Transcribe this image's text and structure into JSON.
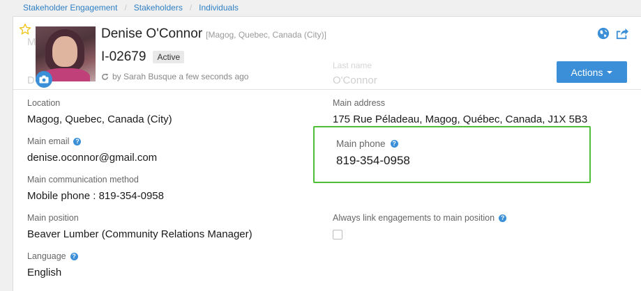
{
  "breadcrumb": [
    "Stakeholder Engagement",
    "Stakeholders",
    "Individuals"
  ],
  "header": {
    "name": "Denise O'Connor",
    "location_tag": "[Magog, Quebec, Canada (City)]",
    "identifier": "I-02679",
    "status": "Active",
    "updated_text": "by Sarah Busque a few seconds ago",
    "actions_label": "Actions",
    "ghost_last_name_label": "Last name",
    "ghost_last_name_value": "O'Connor"
  },
  "details": {
    "location": {
      "label": "Location",
      "value": "Magog, Quebec, Canada (City)"
    },
    "main_address": {
      "label": "Main address",
      "value": "175 Rue Péladeau, Magog, Québec, Canada, J1X 5B3"
    },
    "main_email": {
      "label": "Main email",
      "value": "denise.oconnor@gmail.com"
    },
    "main_phone": {
      "label": "Main phone",
      "value": "819-354-0958"
    },
    "main_communication_method": {
      "label": "Main communication method",
      "value": "Mobile phone : 819-354-0958"
    },
    "main_position": {
      "label": "Main position",
      "value": "Beaver Lumber (Community Relations Manager)"
    },
    "always_link": {
      "label": "Always link engagements to main position",
      "checked": false
    },
    "language": {
      "label": "Language",
      "value": "English"
    }
  },
  "colors": {
    "accent": "#3a8fd8",
    "highlight": "#4cbf35",
    "star": "#f0c419"
  },
  "icons": [
    "star-icon",
    "camera-icon",
    "refresh-icon",
    "globe-icon",
    "share-icon",
    "help-icon",
    "caret-down-icon"
  ]
}
